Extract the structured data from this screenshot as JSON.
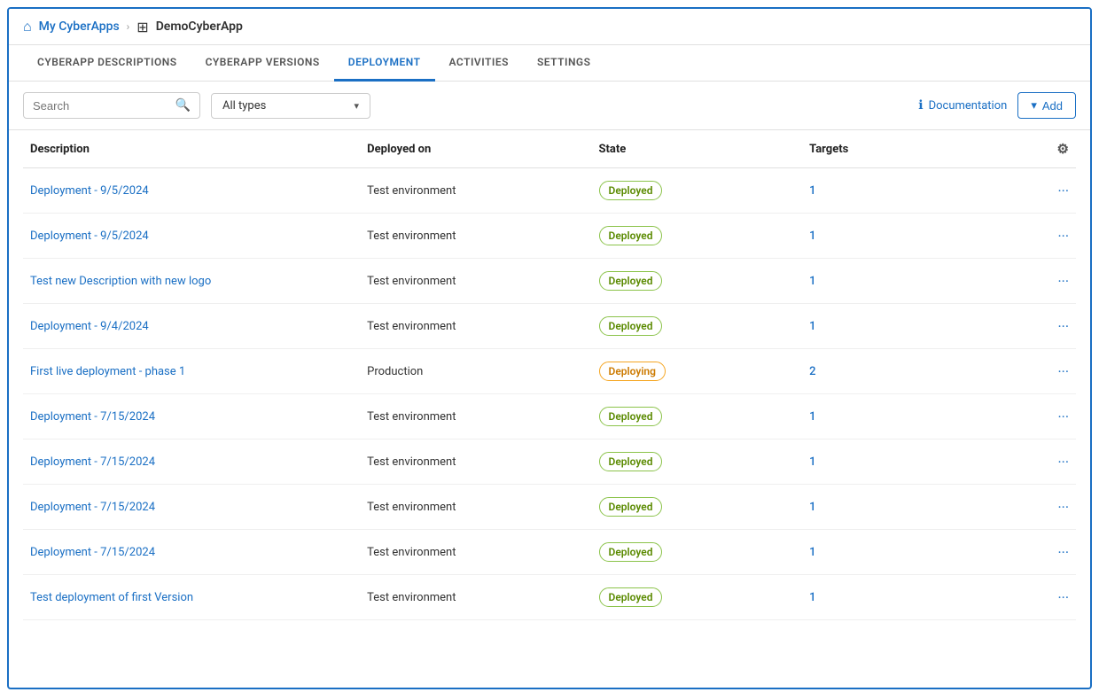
{
  "breadcrumb": {
    "home_label": "My CyberApps",
    "separator": "›",
    "current_label": "DemoCyberApp"
  },
  "tabs": [
    {
      "id": "descriptions",
      "label": "CYBERAPP DESCRIPTIONS",
      "active": false
    },
    {
      "id": "versions",
      "label": "CYBERAPP VERSIONS",
      "active": false
    },
    {
      "id": "deployment",
      "label": "DEPLOYMENT",
      "active": true
    },
    {
      "id": "activities",
      "label": "ACTIVITIES",
      "active": false
    },
    {
      "id": "settings",
      "label": "SETTINGS",
      "active": false
    }
  ],
  "toolbar": {
    "search_placeholder": "Search",
    "filter_label": "All types",
    "documentation_label": "Documentation",
    "add_label": "Add"
  },
  "table": {
    "columns": [
      {
        "id": "description",
        "label": "Description"
      },
      {
        "id": "deployed_on",
        "label": "Deployed on"
      },
      {
        "id": "state",
        "label": "State"
      },
      {
        "id": "targets",
        "label": "Targets"
      },
      {
        "id": "actions",
        "label": "⚙"
      }
    ],
    "rows": [
      {
        "description": "Deployment - 9/5/2024",
        "deployed_on": "Test environment",
        "state": "Deployed",
        "state_type": "deployed",
        "targets": "1"
      },
      {
        "description": "Deployment - 9/5/2024",
        "deployed_on": "Test environment",
        "state": "Deployed",
        "state_type": "deployed",
        "targets": "1"
      },
      {
        "description": "Test new Description with new logo",
        "deployed_on": "Test environment",
        "state": "Deployed",
        "state_type": "deployed",
        "targets": "1"
      },
      {
        "description": "Deployment - 9/4/2024",
        "deployed_on": "Test environment",
        "state": "Deployed",
        "state_type": "deployed",
        "targets": "1"
      },
      {
        "description": "First live deployment - phase 1",
        "deployed_on": "Production",
        "state": "Deploying",
        "state_type": "deploying",
        "targets": "2"
      },
      {
        "description": "Deployment - 7/15/2024",
        "deployed_on": "Test environment",
        "state": "Deployed",
        "state_type": "deployed",
        "targets": "1"
      },
      {
        "description": "Deployment - 7/15/2024",
        "deployed_on": "Test environment",
        "state": "Deployed",
        "state_type": "deployed",
        "targets": "1"
      },
      {
        "description": "Deployment - 7/15/2024",
        "deployed_on": "Test environment",
        "state": "Deployed",
        "state_type": "deployed",
        "targets": "1"
      },
      {
        "description": "Deployment - 7/15/2024",
        "deployed_on": "Test environment",
        "state": "Deployed",
        "state_type": "deployed",
        "targets": "1"
      },
      {
        "description": "Test deployment of first Version",
        "deployed_on": "Test environment",
        "state": "Deployed",
        "state_type": "deployed",
        "targets": "1"
      }
    ]
  }
}
